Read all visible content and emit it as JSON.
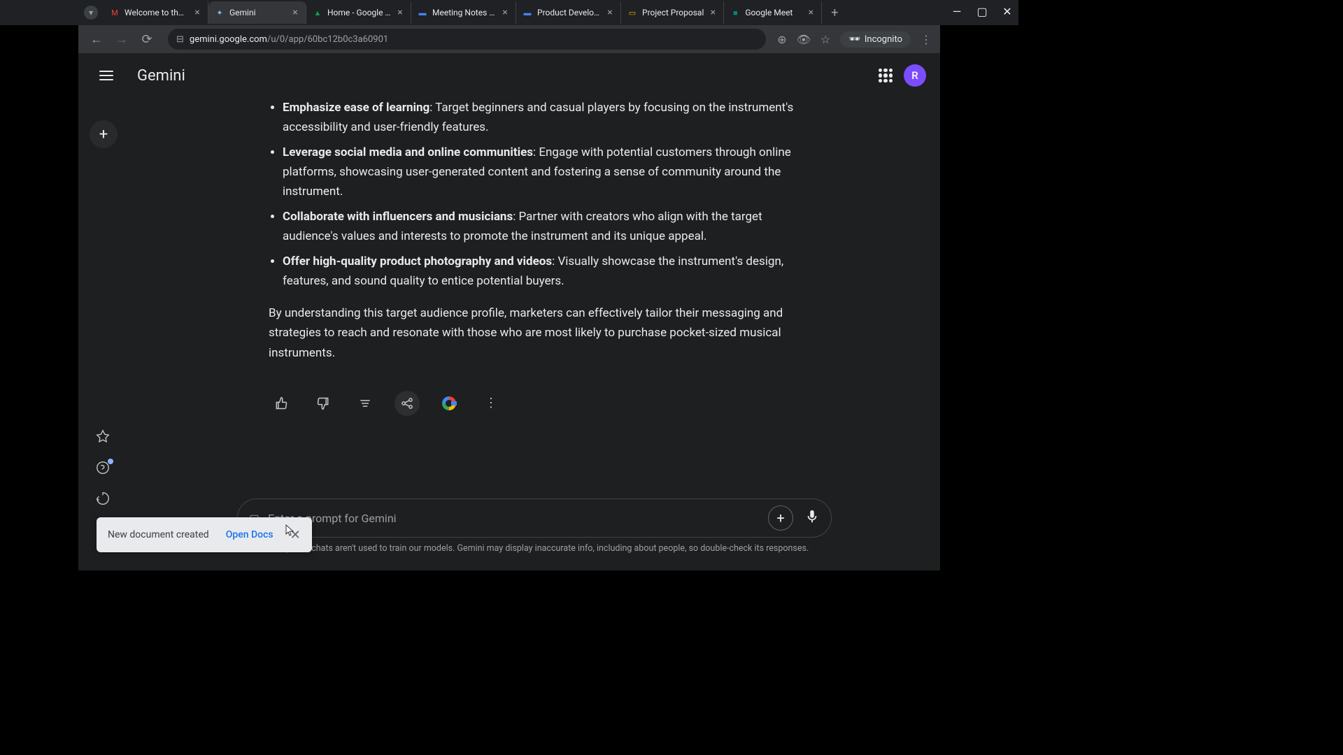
{
  "tabs": [
    {
      "title": "Welcome to the Te",
      "favicon_color": "#ea4335"
    },
    {
      "title": "Gemini",
      "favicon_color": "#8ab4f8",
      "active": true
    },
    {
      "title": "Home - Google Dri",
      "favicon_color": "#0f9d58"
    },
    {
      "title": "Meeting Notes - G",
      "favicon_color": "#4285f4"
    },
    {
      "title": "Product Developm",
      "favicon_color": "#4285f4"
    },
    {
      "title": "Project Proposal",
      "favicon_color": "#f4b400"
    },
    {
      "title": "Google Meet",
      "favicon_color": "#00897b"
    }
  ],
  "url": {
    "prefix": "",
    "domain": "gemini.google.com",
    "path": "/u/0/app/60bc12b0c3a60901"
  },
  "incognito_label": "Incognito",
  "app": {
    "logo_text": "Gemini",
    "avatar_letter": "R"
  },
  "response": {
    "bullets": [
      {
        "bold": "Emphasize ease of learning",
        "text": ": Target beginners and casual players by focusing on the instrument's accessibility and user-friendly features."
      },
      {
        "bold": "Leverage social media and online communities",
        "text": ": Engage with potential customers through online platforms, showcasing user-generated content and fostering a sense of community around the instrument."
      },
      {
        "bold": "Collaborate with influencers and musicians",
        "text": ": Partner with creators who align with the target audience's values and interests to promote the instrument and its unique appeal."
      },
      {
        "bold": "Offer high-quality product photography and videos",
        "text": ": Visually showcase the instrument's design, features, and sound quality to entice potential buyers."
      }
    ],
    "closing": "By understanding this target audience profile, marketers can effectively tailor their messaging and strategies to reach and resonate with those who are most likely to purchase pocket-sized musical instruments."
  },
  "input": {
    "placeholder": "Enter a prompt for Gemini"
  },
  "disclaimer": "Your Cymbal chats aren't used to train our models. Gemini may display inaccurate info, including about people, so double-check its responses.",
  "toast": {
    "message": "New document created",
    "action": "Open Docs"
  }
}
